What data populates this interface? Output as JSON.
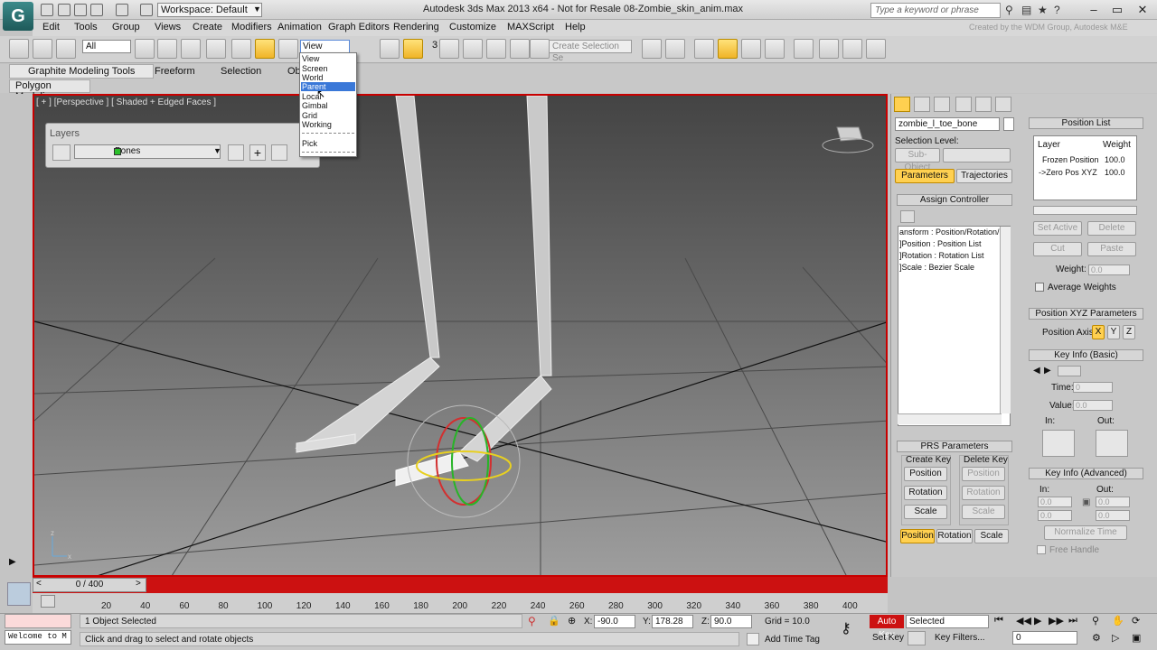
{
  "titlebar": {
    "workspace": "Workspace: Default",
    "title": "Autodesk 3ds Max  2013 x64    - Not for Resale   08-Zombie_skin_anim.max",
    "search_placeholder": "Type a keyword or phrase"
  },
  "menubar": {
    "items": [
      "Edit",
      "Tools",
      "Group",
      "Views",
      "Create",
      "Modifiers",
      "Animation",
      "Graph Editors",
      "Rendering",
      "Customize",
      "MAXScript",
      "Help"
    ],
    "credit": "Created by the WDM Group, Autodesk M&E"
  },
  "toolbar": {
    "selection_filter": "All",
    "ref_coord": "View",
    "named_selection": "Create Selection Se",
    "snap_value": "3"
  },
  "ref_coord_menu": {
    "items": [
      "View",
      "Screen",
      "World",
      "Parent",
      "Local",
      "Gimbal",
      "Grid",
      "Working",
      "Pick"
    ],
    "highlighted": "Parent"
  },
  "ribbon": {
    "tabs": [
      "Graphite Modeling Tools",
      "Freeform",
      "Selection",
      "Ob"
    ],
    "polygon_button": "Polygon Modeling"
  },
  "viewport": {
    "label": "[ + ] [Perspective ] [ Shaded + Edged Faces ]",
    "axis_labels": {
      "z": "z",
      "x": "x",
      "y": "y"
    }
  },
  "layers": {
    "title": "Layers",
    "current_layer": "Bones"
  },
  "command_panel": {
    "object_name": "zombie_l_toe_bone",
    "selection_level": "Selection Level:",
    "sub_object": "Sub-Object",
    "tabs": [
      "Parameters",
      "Trajectories"
    ],
    "assign_controller": "Assign Controller",
    "tree": [
      "ansform : Position/Rotation/S",
      "]Position : Position List",
      "]Rotation : Rotation List",
      "]Scale : Bezier Scale"
    ],
    "prs": {
      "title": "PRS Parameters",
      "create_key": "Create Key",
      "delete_key": "Delete Key",
      "buttons": [
        "Position",
        "Rotation",
        "Scale"
      ],
      "bottom_tabs": [
        "Position",
        "Rotation",
        "Scale"
      ]
    },
    "position_list": {
      "title": "Position List",
      "columns": [
        "Layer",
        "Weight"
      ],
      "rows": [
        {
          "layer": "Frozen Position",
          "weight": "100.0"
        },
        {
          "layer": "->Zero Pos XYZ",
          "weight": "100.0"
        }
      ],
      "buttons": [
        "Set Active",
        "Delete",
        "Cut",
        "Paste"
      ],
      "weight_label": "Weight:",
      "weight_value": "0.0",
      "average_weights": "Average Weights"
    },
    "pos_xyz": {
      "title": "Position XYZ Parameters",
      "axis_label": "Position Axis:",
      "axes": [
        "X",
        "Y",
        "Z"
      ]
    },
    "key_info_basic": {
      "title": "Key Info (Basic)",
      "time_label": "Time:",
      "time_value": "0",
      "value_label": "Value:",
      "value_value": "0.0",
      "in_label": "In:",
      "out_label": "Out:"
    },
    "key_info_adv": {
      "title": "Key Info (Advanced)",
      "in_label": "In:",
      "out_label": "Out:",
      "fields": [
        "0.0",
        "0.0",
        "0.0",
        "0.0"
      ],
      "normalize": "Normalize Time",
      "free_handle": "Free Handle"
    }
  },
  "timeline": {
    "slider": "0 / 400",
    "ticks": [
      "20",
      "40",
      "60",
      "80",
      "100",
      "120",
      "140",
      "160",
      "180",
      "200",
      "220",
      "240",
      "260",
      "280",
      "300",
      "320",
      "340",
      "360",
      "380",
      "400"
    ]
  },
  "status": {
    "listener": "Welcome to M",
    "selected": "1 Object Selected",
    "prompt": "Click and drag to select and rotate objects",
    "x_label": "X:",
    "x": "-90.0",
    "y_label": "Y:",
    "y": "178.28",
    "z_label": "Z:",
    "z": "90.0",
    "grid": "Grid = 10.0",
    "add_time_tag": "Add Time Tag",
    "auto_key": "Auto Key",
    "selected_dropdown": "Selected",
    "set_key": "Set Key",
    "key_filters": "Key Filters...",
    "frame": "0"
  },
  "colors": {
    "accent": "#ffd050",
    "viewport_border": "#c80000",
    "highlight": "#3a78d8"
  }
}
